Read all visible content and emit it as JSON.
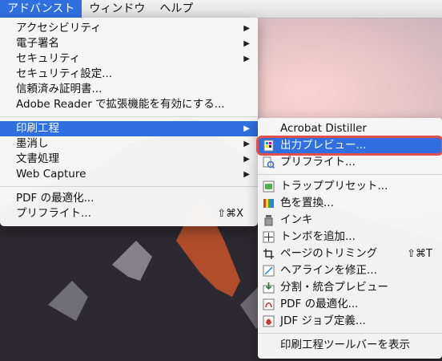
{
  "menubar": {
    "menus": [
      "アドバンスト",
      "ウィンドウ",
      "ヘルプ"
    ]
  },
  "advanced_menu": {
    "items": [
      {
        "label": "アクセシビリティ",
        "submenu": true
      },
      {
        "label": "電子署名",
        "submenu": true
      },
      {
        "label": "セキュリティ",
        "submenu": true
      },
      {
        "label": "セキュリティ設定..."
      },
      {
        "label": "信頼済み証明書..."
      },
      {
        "label": "Adobe Reader で拡張機能を有効にする..."
      },
      {
        "label": "印刷工程",
        "submenu": true,
        "highlighted": true
      },
      {
        "label": "墨消し",
        "submenu": true
      },
      {
        "label": "文書処理",
        "submenu": true
      },
      {
        "label": "Web Capture",
        "submenu": true
      },
      {
        "label": "PDF の最適化..."
      },
      {
        "label": "プリフライト...",
        "shortcut": "⇧⌘X"
      }
    ]
  },
  "print_production_submenu": {
    "items": [
      {
        "label": "Acrobat Distiller",
        "icon": "none"
      },
      {
        "label": "出力プレビュー...",
        "icon": "output-preview-icon",
        "highlighted": true
      },
      {
        "label": "プリフライト...",
        "icon": "preflight-icon"
      },
      {
        "label": "トラッププリセット...",
        "icon": "trap-presets-icon"
      },
      {
        "label": "色を置換...",
        "icon": "convert-colors-icon"
      },
      {
        "label": "インキ",
        "icon": "ink-manager-icon"
      },
      {
        "label": "トンボを追加...",
        "icon": "printer-marks-icon"
      },
      {
        "label": "ページのトリミング",
        "icon": "crop-pages-icon",
        "shortcut": "⇧⌘T"
      },
      {
        "label": "ヘアラインを修正...",
        "icon": "fix-hairlines-icon"
      },
      {
        "label": "分割・統合プレビュー",
        "icon": "flattener-preview-icon"
      },
      {
        "label": "PDF の最適化...",
        "icon": "pdf-optimizer-icon"
      },
      {
        "label": "JDF ジョブ定義...",
        "icon": "jdf-job-definitions-icon"
      },
      {
        "label": "印刷工程ツールバーを表示",
        "icon": "none"
      }
    ]
  },
  "colors": {
    "highlight": "#2f6fe0",
    "annotation_ring": "#e0504a"
  }
}
